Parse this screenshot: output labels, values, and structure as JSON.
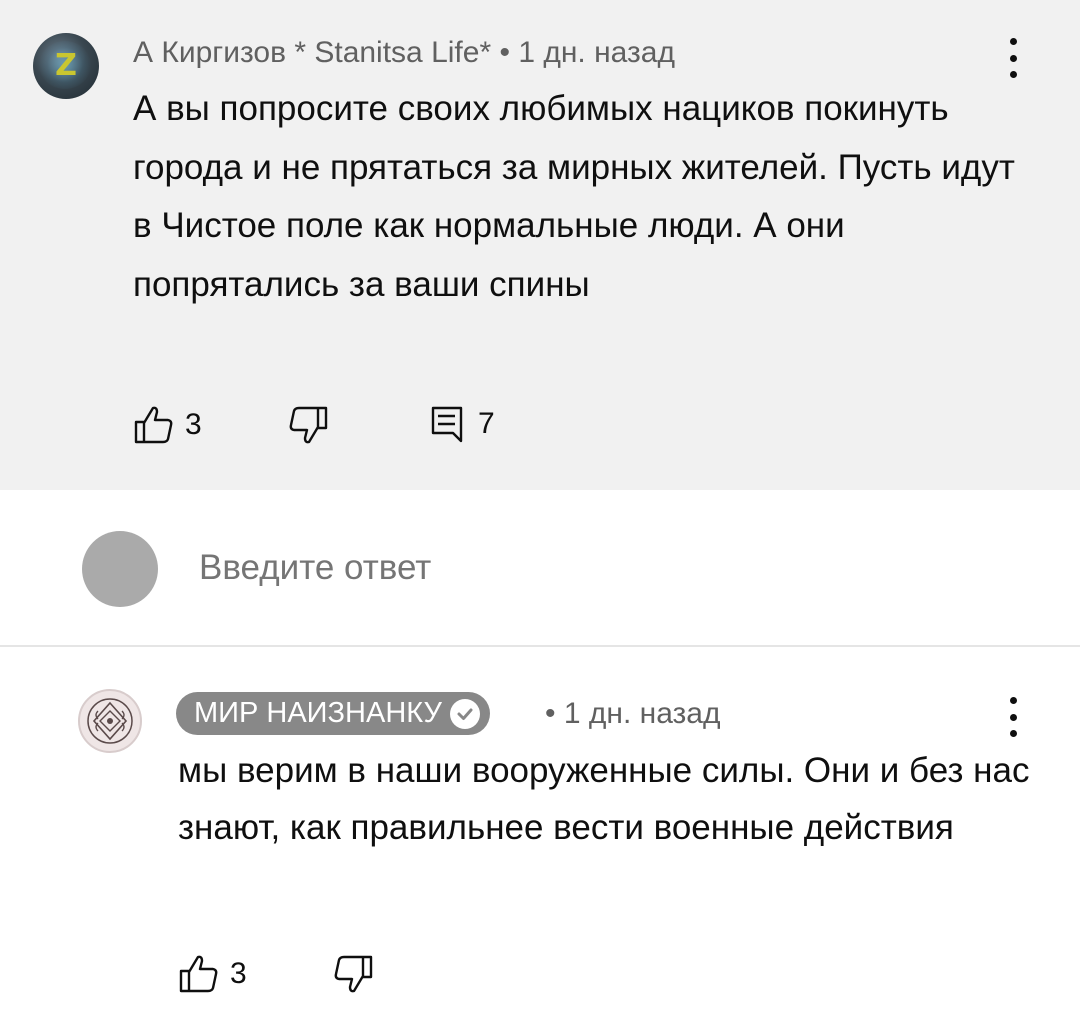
{
  "comment": {
    "author": "А Киргизов * Stanitsa Life*",
    "separator": "•",
    "time": "1 дн. назад",
    "text": "А вы попросите своих любимых нациков покинуть города и не прятаться за мирных жителей. Пусть идут в Чистое поле как нормальные люди. А они попрятались за ваши спины",
    "likes": "3",
    "replies": "7",
    "avatar_letter": "Z"
  },
  "reply_box": {
    "placeholder": "Введите ответ"
  },
  "reply": {
    "author": "МИР НАИЗНАНКУ",
    "separator": "•",
    "time": "1 дн. назад",
    "text": "мы верим в наши вооруженные силы. Они и без нас знают, как правильнее вести военные действия",
    "likes": "3",
    "verified": true
  },
  "icons": {
    "like": "thumbs-up-icon",
    "dislike": "thumbs-down-icon",
    "reply": "comment-icon",
    "menu": "more-vertical-icon",
    "verified": "checkmark-icon"
  },
  "colors": {
    "highlight_bg": "#f1f1f1",
    "secondary_text": "#606060",
    "channel_pill": "#888888"
  }
}
